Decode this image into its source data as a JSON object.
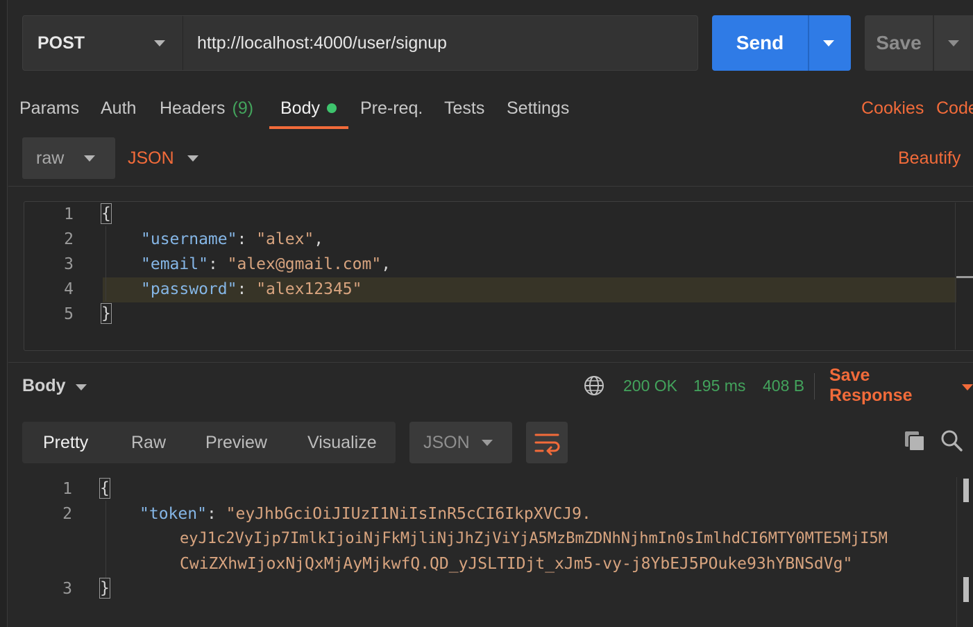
{
  "request": {
    "method": "POST",
    "url": "http://localhost:4000/user/signup",
    "send_label": "Send",
    "save_label": "Save"
  },
  "tabs": {
    "params": "Params",
    "auth": "Auth",
    "headers": "Headers",
    "headers_count": "(9)",
    "body": "Body",
    "prereq": "Pre-req.",
    "tests": "Tests",
    "settings": "Settings",
    "cookies": "Cookies",
    "code": "Code"
  },
  "body_options": {
    "mode": "raw",
    "language": "JSON",
    "beautify": "Beautify"
  },
  "request_body": {
    "line_numbers": [
      "1",
      "2",
      "3",
      "4",
      "5"
    ],
    "open_brace": "{",
    "close_brace": "}",
    "username_key": "\"username\"",
    "username_value": "\"alex\"",
    "email_key": "\"email\"",
    "email_value": "\"alex@gmail.com\"",
    "password_key": "\"password\"",
    "password_value": "\"alex12345\""
  },
  "response": {
    "section_label": "Body",
    "status": "200 OK",
    "time": "195 ms",
    "size": "408 B",
    "save_response": "Save Response",
    "view_tabs": [
      "Pretty",
      "Raw",
      "Preview",
      "Visualize"
    ],
    "format": "JSON",
    "line_numbers": [
      "1",
      "2",
      "3"
    ],
    "open_brace": "{",
    "close_brace": "}",
    "token_key": "\"token\"",
    "token_line1": "\"eyJhbGciOiJIUzI1NiIsInR5cCI6IkpXVCJ9.",
    "token_line2": "eyJ1c2VyIjp7ImlkIjoiNjFkMjliNjJhZjViYjA5MzBmZDNhNjhmIn0sImlhdCI6MTY0MTE5MjI5M",
    "token_line3": "CwiZXhwIjoxNjQxMjAyMjkwfQ.QD_yJSLTIDjt_xJm5-vy-j8YbEJ5POuke93hYBNSdVg\""
  },
  "colors": {
    "accent": "#f26b3a",
    "send": "#2f7be6",
    "success": "#43a35c",
    "json_key": "#85b6e6",
    "json_string": "#d8a47f"
  },
  "icons": [
    "caret-down-icon",
    "status-dot-icon",
    "globe-icon",
    "wrap-lines-icon",
    "copy-icon",
    "search-icon"
  ]
}
